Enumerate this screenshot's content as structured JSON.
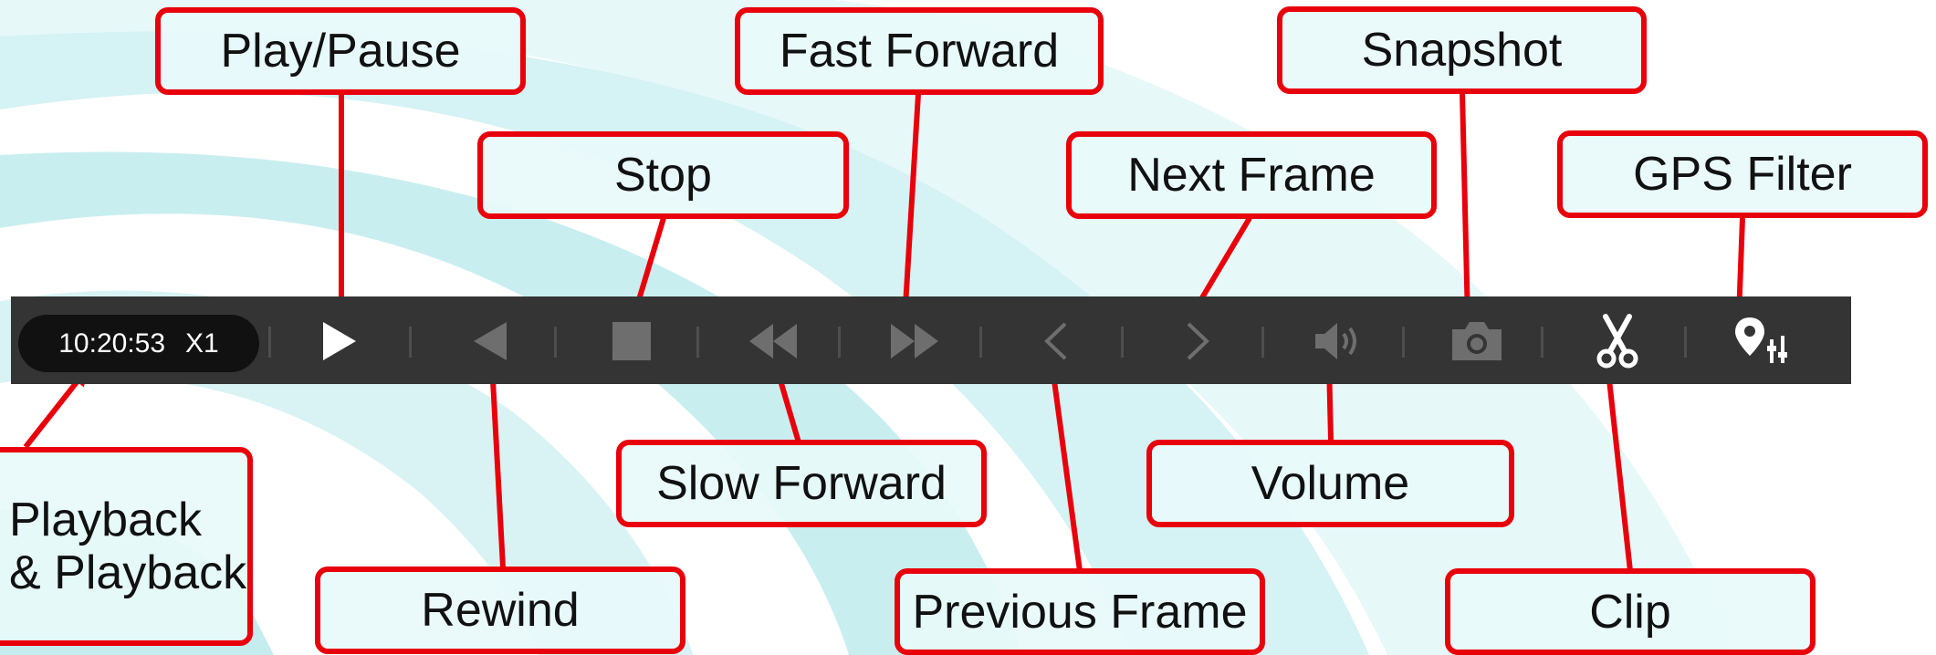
{
  "player": {
    "time": "10:20:53",
    "speed": "X1"
  },
  "callouts": {
    "play_pause": "Play/Pause",
    "fast_forward": "Fast Forward",
    "snapshot": "Snapshot",
    "stop": "Stop",
    "next_frame": "Next Frame",
    "gps_filter": "GPS Filter",
    "playback_line1": "Playback",
    "playback_line2": "& Playback",
    "slow_forward": "Slow Forward",
    "volume": "Volume",
    "rewind": "Rewind",
    "previous_frame": "Previous Frame",
    "clip": "Clip"
  },
  "toolbar_buttons": [
    {
      "icon": "play-icon",
      "state": "enabled"
    },
    {
      "icon": "rewind-icon",
      "state": "disabled"
    },
    {
      "icon": "stop-icon",
      "state": "disabled"
    },
    {
      "icon": "slow-forward-icon",
      "state": "disabled"
    },
    {
      "icon": "fast-forward-icon",
      "state": "disabled"
    },
    {
      "icon": "previous-frame-icon",
      "state": "disabled"
    },
    {
      "icon": "next-frame-icon",
      "state": "disabled"
    },
    {
      "icon": "volume-icon",
      "state": "disabled"
    },
    {
      "icon": "camera-icon",
      "state": "disabled"
    },
    {
      "icon": "scissors-icon",
      "state": "enabled"
    },
    {
      "icon": "gps-filter-icon",
      "state": "enabled"
    }
  ],
  "colors": {
    "callout_border": "#e8000b",
    "toolbar_bg": "#343434",
    "time_pill_bg": "#111111",
    "icon_enabled": "#ffffff",
    "icon_disabled": "#6e6e6e",
    "background_swoosh": "#c9eef0"
  }
}
